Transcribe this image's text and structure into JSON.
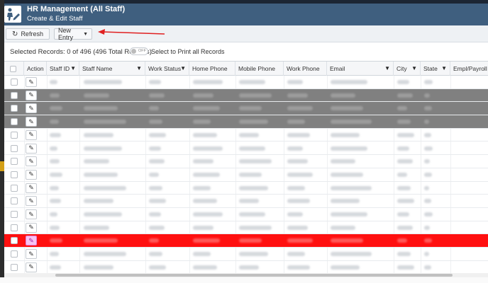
{
  "header": {
    "title": "HR Management (All Staff)",
    "subtitle": "Create & Edit Staff",
    "app_icon": "staff-edit-icon"
  },
  "toolbar": {
    "refresh_label": "Refresh",
    "new_entry_label": "New Entry"
  },
  "selection": {
    "info": "Selected Records: 0 of 496 (496 Total Records)",
    "toggle_state": "OFF",
    "toggle_label": "Select to Print all Records"
  },
  "table": {
    "columns": [
      {
        "key": "select",
        "label": ""
      },
      {
        "key": "action",
        "label": "Action"
      },
      {
        "key": "staff_id",
        "label": "Staff ID"
      },
      {
        "key": "staff_name",
        "label": "Staff Name"
      },
      {
        "key": "work_status",
        "label": "Work Status"
      },
      {
        "key": "home_phone",
        "label": "Home Phone"
      },
      {
        "key": "mobile_phone",
        "label": "Mobile Phone"
      },
      {
        "key": "work_phone",
        "label": "Work Phone"
      },
      {
        "key": "email",
        "label": "Email"
      },
      {
        "key": "city",
        "label": "City"
      },
      {
        "key": "state",
        "label": "State"
      },
      {
        "key": "empl_payroll_id",
        "label": "Empl/Payroll ID"
      }
    ],
    "row_states": [
      "normal",
      "gray",
      "gray",
      "gray",
      "normal",
      "normal",
      "normal",
      "normal",
      "normal",
      "normal",
      "normal",
      "normal",
      "red",
      "normal",
      "normal",
      "gray"
    ]
  },
  "colors": {
    "header_bg": "#3f5f7f",
    "gray_row": "#808080",
    "red_row": "#ff1010",
    "annotation_arrow": "#e02020"
  }
}
